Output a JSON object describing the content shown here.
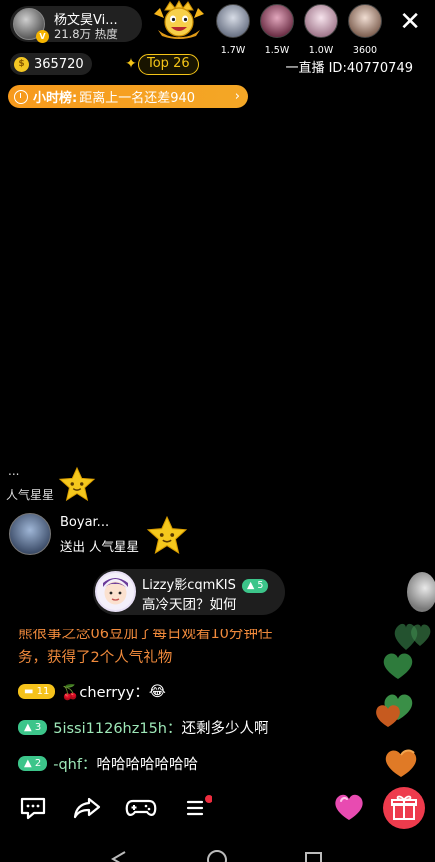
{
  "host": {
    "name": "杨文昊Vi...",
    "heat": "21.8万 热度",
    "verified_badge": "V"
  },
  "viewers": [
    {
      "value": "1.7W",
      "color": "#a0a8b8"
    },
    {
      "value": "1.5W",
      "color": "#b06d8a"
    },
    {
      "value": "1.0W",
      "color": "#d8b7c8"
    },
    {
      "value": "3600",
      "color": "#c7a99a"
    }
  ],
  "coins": {
    "value": "365720",
    "icon_glyph": "$"
  },
  "rank_badge": {
    "label": "Top 26"
  },
  "room": {
    "label": "一直播 ID:40770749"
  },
  "hour_rank": {
    "label": "小时榜:",
    "text": "距离上一名还差940",
    "arrow": "›"
  },
  "close_glyph": "✕",
  "faded_notice": {
    "name": "...",
    "text": "人气星星"
  },
  "gift_notice": {
    "name": "Boyar...",
    "text": "送出 人气星星"
  },
  "enter_notice": {
    "name": "Lizzy影cqmKIS",
    "level": "5",
    "message": "高冷天团？如何"
  },
  "system_message": {
    "line1": "熊很事之念06豆加了每日观看10分钟任",
    "line2": "务，获得了2个人气礼物"
  },
  "chat": [
    {
      "level": "11",
      "level_color": "#f5c21b",
      "user": "🍒cherryy：",
      "message": "😂",
      "user_color": "#ffffff"
    },
    {
      "level": "3",
      "level_color": "#3cc58a",
      "user": "5issi1126hz15h：",
      "message": "还剩多少人啊",
      "user_color": "#9ee8b8"
    },
    {
      "level": "2",
      "level_color": "#3cc58a",
      "user": "-qhf：",
      "message": "哈哈哈哈哈哈哈",
      "user_color": "#9ee8b8"
    }
  ],
  "colors": {
    "accent_orange": "#f79a1c",
    "gold": "#f5c518",
    "gift_red": "#ee3b4d",
    "level_green": "#3cc58a"
  },
  "icons": [
    "comment-icon",
    "share-icon",
    "gamepad-icon",
    "menu-icon",
    "heart-like-icon",
    "gift-icon",
    "nav-back-icon",
    "nav-home-icon",
    "nav-recent-icon"
  ]
}
